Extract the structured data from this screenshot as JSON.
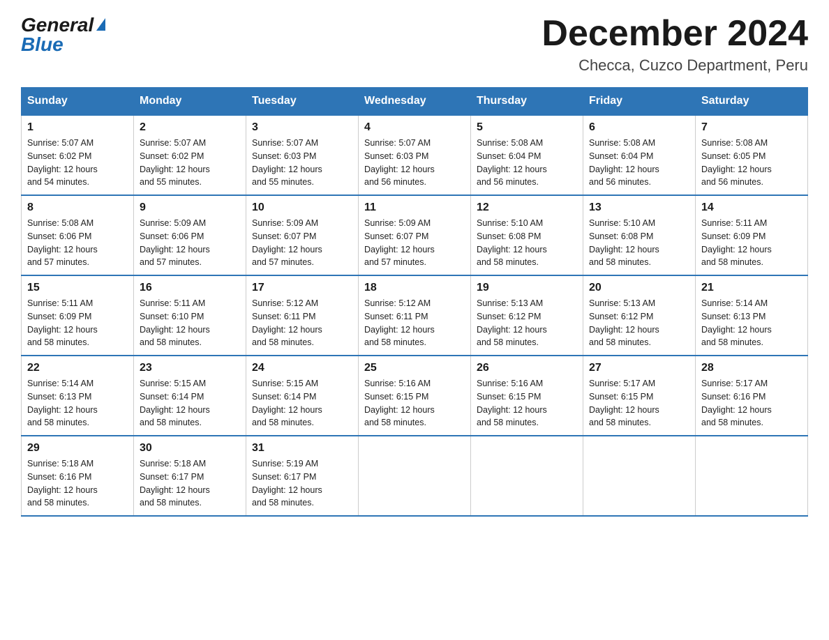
{
  "logo": {
    "general": "General",
    "blue": "Blue"
  },
  "title": "December 2024",
  "subtitle": "Checca, Cuzco Department, Peru",
  "headers": [
    "Sunday",
    "Monday",
    "Tuesday",
    "Wednesday",
    "Thursday",
    "Friday",
    "Saturday"
  ],
  "weeks": [
    [
      {
        "day": "1",
        "info": "Sunrise: 5:07 AM\nSunset: 6:02 PM\nDaylight: 12 hours\nand 54 minutes."
      },
      {
        "day": "2",
        "info": "Sunrise: 5:07 AM\nSunset: 6:02 PM\nDaylight: 12 hours\nand 55 minutes."
      },
      {
        "day": "3",
        "info": "Sunrise: 5:07 AM\nSunset: 6:03 PM\nDaylight: 12 hours\nand 55 minutes."
      },
      {
        "day": "4",
        "info": "Sunrise: 5:07 AM\nSunset: 6:03 PM\nDaylight: 12 hours\nand 56 minutes."
      },
      {
        "day": "5",
        "info": "Sunrise: 5:08 AM\nSunset: 6:04 PM\nDaylight: 12 hours\nand 56 minutes."
      },
      {
        "day": "6",
        "info": "Sunrise: 5:08 AM\nSunset: 6:04 PM\nDaylight: 12 hours\nand 56 minutes."
      },
      {
        "day": "7",
        "info": "Sunrise: 5:08 AM\nSunset: 6:05 PM\nDaylight: 12 hours\nand 56 minutes."
      }
    ],
    [
      {
        "day": "8",
        "info": "Sunrise: 5:08 AM\nSunset: 6:06 PM\nDaylight: 12 hours\nand 57 minutes."
      },
      {
        "day": "9",
        "info": "Sunrise: 5:09 AM\nSunset: 6:06 PM\nDaylight: 12 hours\nand 57 minutes."
      },
      {
        "day": "10",
        "info": "Sunrise: 5:09 AM\nSunset: 6:07 PM\nDaylight: 12 hours\nand 57 minutes."
      },
      {
        "day": "11",
        "info": "Sunrise: 5:09 AM\nSunset: 6:07 PM\nDaylight: 12 hours\nand 57 minutes."
      },
      {
        "day": "12",
        "info": "Sunrise: 5:10 AM\nSunset: 6:08 PM\nDaylight: 12 hours\nand 58 minutes."
      },
      {
        "day": "13",
        "info": "Sunrise: 5:10 AM\nSunset: 6:08 PM\nDaylight: 12 hours\nand 58 minutes."
      },
      {
        "day": "14",
        "info": "Sunrise: 5:11 AM\nSunset: 6:09 PM\nDaylight: 12 hours\nand 58 minutes."
      }
    ],
    [
      {
        "day": "15",
        "info": "Sunrise: 5:11 AM\nSunset: 6:09 PM\nDaylight: 12 hours\nand 58 minutes."
      },
      {
        "day": "16",
        "info": "Sunrise: 5:11 AM\nSunset: 6:10 PM\nDaylight: 12 hours\nand 58 minutes."
      },
      {
        "day": "17",
        "info": "Sunrise: 5:12 AM\nSunset: 6:11 PM\nDaylight: 12 hours\nand 58 minutes."
      },
      {
        "day": "18",
        "info": "Sunrise: 5:12 AM\nSunset: 6:11 PM\nDaylight: 12 hours\nand 58 minutes."
      },
      {
        "day": "19",
        "info": "Sunrise: 5:13 AM\nSunset: 6:12 PM\nDaylight: 12 hours\nand 58 minutes."
      },
      {
        "day": "20",
        "info": "Sunrise: 5:13 AM\nSunset: 6:12 PM\nDaylight: 12 hours\nand 58 minutes."
      },
      {
        "day": "21",
        "info": "Sunrise: 5:14 AM\nSunset: 6:13 PM\nDaylight: 12 hours\nand 58 minutes."
      }
    ],
    [
      {
        "day": "22",
        "info": "Sunrise: 5:14 AM\nSunset: 6:13 PM\nDaylight: 12 hours\nand 58 minutes."
      },
      {
        "day": "23",
        "info": "Sunrise: 5:15 AM\nSunset: 6:14 PM\nDaylight: 12 hours\nand 58 minutes."
      },
      {
        "day": "24",
        "info": "Sunrise: 5:15 AM\nSunset: 6:14 PM\nDaylight: 12 hours\nand 58 minutes."
      },
      {
        "day": "25",
        "info": "Sunrise: 5:16 AM\nSunset: 6:15 PM\nDaylight: 12 hours\nand 58 minutes."
      },
      {
        "day": "26",
        "info": "Sunrise: 5:16 AM\nSunset: 6:15 PM\nDaylight: 12 hours\nand 58 minutes."
      },
      {
        "day": "27",
        "info": "Sunrise: 5:17 AM\nSunset: 6:15 PM\nDaylight: 12 hours\nand 58 minutes."
      },
      {
        "day": "28",
        "info": "Sunrise: 5:17 AM\nSunset: 6:16 PM\nDaylight: 12 hours\nand 58 minutes."
      }
    ],
    [
      {
        "day": "29",
        "info": "Sunrise: 5:18 AM\nSunset: 6:16 PM\nDaylight: 12 hours\nand 58 minutes."
      },
      {
        "day": "30",
        "info": "Sunrise: 5:18 AM\nSunset: 6:17 PM\nDaylight: 12 hours\nand 58 minutes."
      },
      {
        "day": "31",
        "info": "Sunrise: 5:19 AM\nSunset: 6:17 PM\nDaylight: 12 hours\nand 58 minutes."
      },
      null,
      null,
      null,
      null
    ]
  ]
}
